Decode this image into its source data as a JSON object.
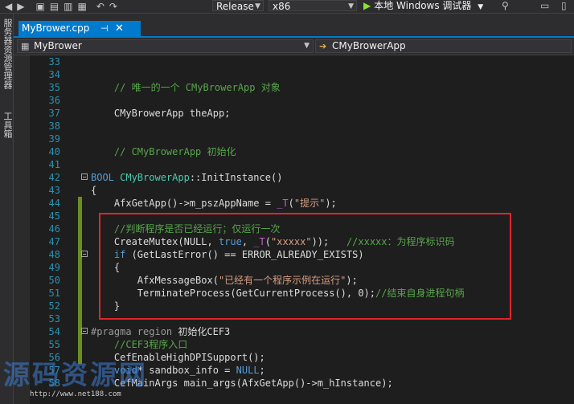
{
  "toolbar": {
    "config": "Release",
    "platform": "x86",
    "run_label": "本地 Windows 调试器",
    "icons": [
      "back-icon",
      "forward-icon",
      "new-item-icon",
      "open-icon",
      "save-icon",
      "save-all-icon",
      "undo-icon",
      "redo-icon"
    ]
  },
  "sidebar": {
    "tabs": [
      "服务器资源管理器",
      "工具箱"
    ]
  },
  "tabs": [
    {
      "label": "MyBrower.cpp",
      "pin": "⊣",
      "close": "✕",
      "active": true
    }
  ],
  "navigation": {
    "project": "MyBrower",
    "scope": "CMyBrowerApp"
  },
  "code_lines": [
    {
      "n": "33",
      "segs": []
    },
    {
      "n": "34",
      "segs": []
    },
    {
      "n": "35",
      "segs": [
        {
          "t": "    // 唯一的一个 CMyBrowerApp 对象",
          "c": "#57a64a"
        }
      ]
    },
    {
      "n": "36",
      "segs": []
    },
    {
      "n": "37",
      "segs": [
        {
          "t": "    CMyBrowerApp theApp;",
          "c": "#dcdcdc"
        }
      ]
    },
    {
      "n": "38",
      "segs": []
    },
    {
      "n": "39",
      "segs": []
    },
    {
      "n": "40",
      "segs": [
        {
          "t": "    // CMyBrowerApp 初始化",
          "c": "#57a64a"
        }
      ]
    },
    {
      "n": "41",
      "segs": []
    },
    {
      "n": "42",
      "fold": true,
      "segs": [
        {
          "t": "BOOL ",
          "c": "#569cd6"
        },
        {
          "t": "CMyBrowerApp",
          "c": "#4ec9b0"
        },
        {
          "t": "::InitInstance()",
          "c": "#dcdcdc"
        }
      ]
    },
    {
      "n": "43",
      "segs": [
        {
          "t": "{",
          "c": "#dcdcdc"
        }
      ]
    },
    {
      "n": "44",
      "segs": [
        {
          "t": "    AfxGetApp()->m_pszAppName = ",
          "c": "#dcdcdc"
        },
        {
          "t": "_T",
          "c": "#bd63c5"
        },
        {
          "t": "(",
          "c": "#dcdcdc"
        },
        {
          "t": "\"提示\"",
          "c": "#d69d85"
        },
        {
          "t": ");",
          "c": "#dcdcdc"
        }
      ]
    },
    {
      "n": "45",
      "segs": []
    },
    {
      "n": "46",
      "segs": [
        {
          "t": "    //判断程序是否已经运行；仅运行一次",
          "c": "#57a64a"
        }
      ]
    },
    {
      "n": "47",
      "segs": [
        {
          "t": "    CreateMutex(NULL, ",
          "c": "#dcdcdc"
        },
        {
          "t": "true",
          "c": "#569cd6"
        },
        {
          "t": ", ",
          "c": "#dcdcdc"
        },
        {
          "t": "_T",
          "c": "#bd63c5"
        },
        {
          "t": "(",
          "c": "#dcdcdc"
        },
        {
          "t": "\"xxxxx\"",
          "c": "#d69d85"
        },
        {
          "t": "));   ",
          "c": "#dcdcdc"
        },
        {
          "t": "//xxxxx：为程序标识码",
          "c": "#57a64a"
        }
      ]
    },
    {
      "n": "48",
      "fold": true,
      "segs": [
        {
          "t": "    ",
          "c": "#dcdcdc"
        },
        {
          "t": "if",
          "c": "#569cd6"
        },
        {
          "t": " (GetLastError() == ERROR_ALREADY_EXISTS)",
          "c": "#dcdcdc"
        }
      ]
    },
    {
      "n": "49",
      "segs": [
        {
          "t": "    {",
          "c": "#dcdcdc"
        }
      ]
    },
    {
      "n": "50",
      "segs": [
        {
          "t": "        AfxMessageBox(",
          "c": "#dcdcdc"
        },
        {
          "t": "\"已经有一个程序示例在运行\"",
          "c": "#d69d85"
        },
        {
          "t": ");",
          "c": "#dcdcdc"
        }
      ]
    },
    {
      "n": "51",
      "segs": [
        {
          "t": "        TerminateProcess(GetCurrentProcess(), 0);",
          "c": "#dcdcdc"
        },
        {
          "t": "//结束自身进程句柄",
          "c": "#57a64a"
        }
      ]
    },
    {
      "n": "52",
      "segs": [
        {
          "t": "    }",
          "c": "#dcdcdc"
        }
      ]
    },
    {
      "n": "53",
      "segs": []
    },
    {
      "n": "54",
      "fold": true,
      "segs": [
        {
          "t": "#pragma region ",
          "c": "#9b9b9b"
        },
        {
          "t": "初始化CEF3",
          "c": "#dcdcdc"
        }
      ]
    },
    {
      "n": "55",
      "segs": [
        {
          "t": "    //CEF3程序入口",
          "c": "#57a64a"
        }
      ]
    },
    {
      "n": "56",
      "segs": [
        {
          "t": "    CefEnableHighDPISupport();",
          "c": "#dcdcdc"
        }
      ]
    },
    {
      "n": "57",
      "segs": [
        {
          "t": "    ",
          "c": "#dcdcdc"
        },
        {
          "t": "void",
          "c": "#569cd6"
        },
        {
          "t": "* sandbox_info = ",
          "c": "#dcdcdc"
        },
        {
          "t": "NULL",
          "c": "#569cd6"
        },
        {
          "t": ";",
          "c": "#dcdcdc"
        }
      ]
    },
    {
      "n": "58",
      "segs": [
        {
          "t": "    CefMainArgs main_args(AfxGetApp()->m_hInstance);",
          "c": "#dcdcdc"
        }
      ]
    }
  ],
  "watermark": {
    "text": "源码资源网",
    "url": "http://www.net188.com"
  }
}
